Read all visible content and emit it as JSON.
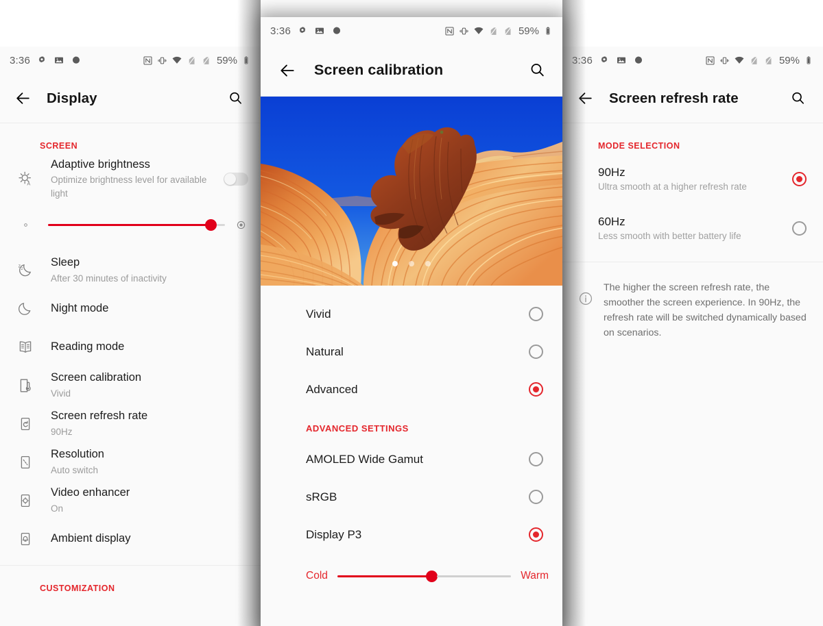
{
  "status_bar": {
    "time": "3:36",
    "battery_percent": "59%",
    "icons_left": [
      "settings-gear-icon",
      "photo-icon",
      "app-dot-icon"
    ],
    "icons_right": [
      "nfc-icon",
      "vibrate-icon",
      "wifi-icon",
      "sim1-off-icon",
      "sim2-off-icon",
      "battery-icon"
    ]
  },
  "left_panel": {
    "title": "Display",
    "back_icon": "back-arrow-icon",
    "search_icon": "search-icon",
    "section_screen": "SCREEN",
    "section_customization": "CUSTOMIZATION",
    "adaptive": {
      "title": "Adaptive brightness",
      "subtitle": "Optimize brightness level for available light",
      "toggle_state": "off",
      "icon": "adaptive-brightness-icon"
    },
    "brightness": {
      "value_percent": 92,
      "min_icon": "brightness-low-icon",
      "max_icon": "brightness-high-icon"
    },
    "items": [
      {
        "title": "Sleep",
        "subtitle": "After 30 minutes of inactivity",
        "icon": "sleep-moon-icon"
      },
      {
        "title": "Night mode",
        "subtitle": "",
        "icon": "night-mode-moon-icon"
      },
      {
        "title": "Reading mode",
        "subtitle": "",
        "icon": "reading-mode-book-icon"
      },
      {
        "title": "Screen calibration",
        "subtitle": "Vivid",
        "icon": "screen-calibration-icon"
      },
      {
        "title": "Screen refresh rate",
        "subtitle": "90Hz",
        "icon": "screen-refresh-rate-icon"
      },
      {
        "title": "Resolution",
        "subtitle": "Auto switch",
        "icon": "resolution-icon"
      },
      {
        "title": "Video enhancer",
        "subtitle": "On",
        "icon": "video-enhancer-icon"
      },
      {
        "title": "Ambient display",
        "subtitle": "",
        "icon": "ambient-display-icon"
      }
    ]
  },
  "center_panel": {
    "title": "Screen calibration",
    "back_icon": "back-arrow-icon",
    "search_icon": "search-icon",
    "carousel": {
      "image_description": "The Wave sandstone rock formation under a deep blue sky",
      "dots": 3,
      "active_dot": 1
    },
    "modes": [
      {
        "label": "Vivid",
        "selected": false
      },
      {
        "label": "Natural",
        "selected": false
      },
      {
        "label": "Advanced",
        "selected": true
      }
    ],
    "advanced_header": "ADVANCED SETTINGS",
    "advanced_modes": [
      {
        "label": "AMOLED Wide Gamut",
        "selected": false
      },
      {
        "label": "sRGB",
        "selected": false
      },
      {
        "label": "Display P3",
        "selected": true
      }
    ],
    "temperature": {
      "cold_label": "Cold",
      "warm_label": "Warm",
      "value_percent": 54
    }
  },
  "right_panel": {
    "title": "Screen refresh rate",
    "back_icon": "back-arrow-icon",
    "search_icon": "search-icon",
    "section_header": "MODE SELECTION",
    "modes": [
      {
        "title": "90Hz",
        "subtitle": "Ultra smooth at a higher refresh rate",
        "selected": true
      },
      {
        "title": "60Hz",
        "subtitle": "Less smooth with better battery life",
        "selected": false
      }
    ],
    "info_icon": "info-icon",
    "info_text": "The higher the screen refresh rate, the smoother the screen experience. In 90Hz, the refresh rate will be switched dynamically based on scenarios."
  },
  "colors": {
    "accent_red": "#e4262c",
    "slider_red": "#e1001a",
    "panel_bg": "#fafafa",
    "title_text": "#1c1c1c",
    "subtitle_text": "#9b9b9b"
  }
}
